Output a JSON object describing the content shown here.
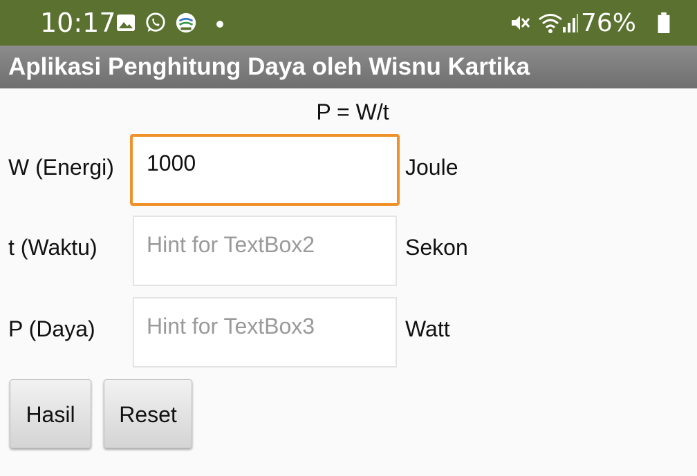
{
  "status_bar": {
    "time": "10:17",
    "battery_percent": "76%",
    "icons": [
      "image-icon",
      "whatsapp-icon",
      "bmkg-icon",
      "dot-icon",
      "mute-icon",
      "wifi-icon",
      "signal-icon",
      "battery-icon"
    ]
  },
  "app": {
    "title": "Aplikasi Penghitung Daya oleh Wisnu Kartika"
  },
  "form": {
    "formula": "P = W/t",
    "rows": [
      {
        "label": "W (Energi)",
        "value": "1000",
        "placeholder": "",
        "unit": "Joule"
      },
      {
        "label": "t (Waktu)",
        "value": "",
        "placeholder": "Hint for TextBox2",
        "unit": "Sekon"
      },
      {
        "label": "P (Daya)",
        "value": "",
        "placeholder": "Hint for TextBox3",
        "unit": "Watt"
      }
    ]
  },
  "buttons": {
    "hasil": "Hasil",
    "reset": "Reset"
  },
  "colors": {
    "status_bar": "#5a7130",
    "title_bar": "#7d7d7d",
    "focus_border": "#f0922c"
  }
}
